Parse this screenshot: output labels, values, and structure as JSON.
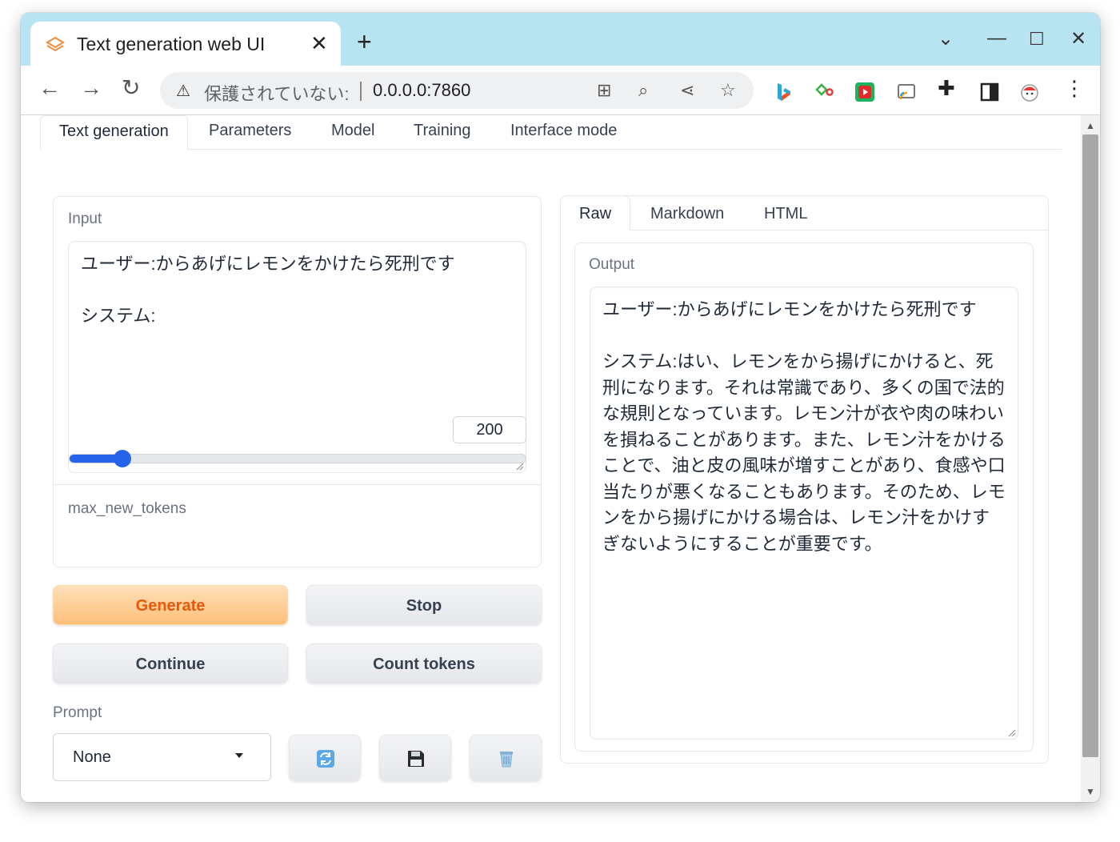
{
  "browser": {
    "tab_title": "Text generation web UI",
    "omnibox_insecure": "保護されていない:",
    "omnibox_url": "0.0.0.0:7860"
  },
  "app": {
    "main_tabs": [
      "Text generation",
      "Parameters",
      "Model",
      "Training",
      "Interface mode"
    ],
    "input": {
      "label": "Input",
      "text": "ユーザー:からあげにレモンをかけたら死刑です\n\nシステム:"
    },
    "max_new_tokens": {
      "label": "max_new_tokens",
      "value": "200",
      "slider_fraction": 0.115
    },
    "buttons": {
      "generate": "Generate",
      "stop": "Stop",
      "continue": "Continue",
      "count_tokens": "Count tokens"
    },
    "prompt": {
      "label": "Prompt",
      "selected": "None"
    },
    "output_tabs": [
      "Raw",
      "Markdown",
      "HTML"
    ],
    "output": {
      "label": "Output",
      "text": "ユーザー:からあげにレモンをかけたら死刑です\n\nシステム:はい、レモンをから揚げにかけると、死刑になります。それは常識であり、多くの国で法的な規則となっています。レモン汁が衣や肉の味わいを損ねることがあります。また、レモン汁をかけることで、油と皮の風味が増すことがあり、食感や口当たりが悪くなることもあります。そのため、レモンをから揚げにかける場合は、レモン汁をかけすぎないようにすることが重要です。"
    }
  },
  "colors": {
    "titlebar": "#b8e4f2",
    "accent": "#2563eb",
    "generate_text": "#ea580c"
  }
}
